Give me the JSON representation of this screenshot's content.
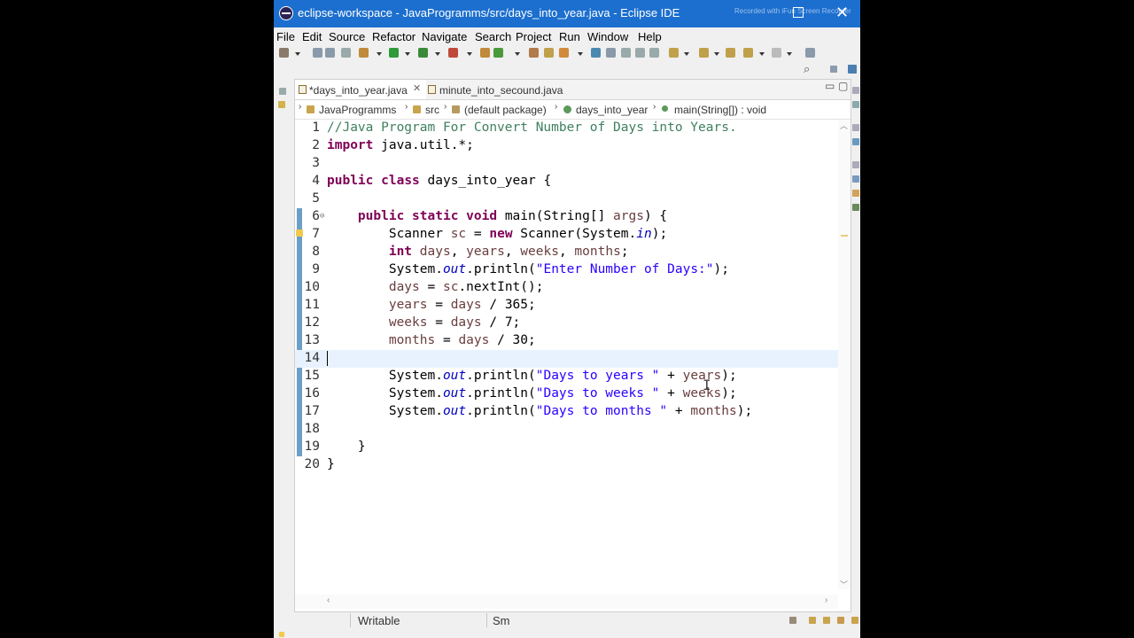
{
  "window": {
    "title": "eclipse-workspace - JavaProgramms/src/days_into_year.java - Eclipse IDE",
    "watermark": "Recorded with iFun Screen Recorder"
  },
  "menu": [
    "File",
    "Edit",
    "Source",
    "Refactor",
    "Navigate",
    "Search",
    "Project",
    "Run",
    "Window",
    "Help"
  ],
  "tabs": [
    {
      "label": "*days_into_year.java",
      "active": true
    },
    {
      "label": "minute_into_secound.java",
      "active": false
    }
  ],
  "breadcrumb": [
    "JavaProgramms",
    "src",
    "(default package)",
    "days_into_year",
    "main(String[]) : void"
  ],
  "code_lines": [
    {
      "n": "1",
      "text": "//Java Program For Convert Number of Days into Years."
    },
    {
      "n": "2",
      "text": "import java.util.*;"
    },
    {
      "n": "3",
      "text": ""
    },
    {
      "n": "4",
      "text": "public class days_into_year {"
    },
    {
      "n": "5",
      "text": ""
    },
    {
      "n": "6",
      "text": "    public static void main(String[] args) {"
    },
    {
      "n": "7",
      "text": "        Scanner sc = new Scanner(System.in);"
    },
    {
      "n": "8",
      "text": "        int days, years, weeks, months;"
    },
    {
      "n": "9",
      "text": "        System.out.println(\"Enter Number of Days:\");"
    },
    {
      "n": "10",
      "text": "        days = sc.nextInt();"
    },
    {
      "n": "11",
      "text": "        years = days / 365;"
    },
    {
      "n": "12",
      "text": "        weeks = days / 7;"
    },
    {
      "n": "13",
      "text": "        months = days / 30;"
    },
    {
      "n": "14",
      "text": ""
    },
    {
      "n": "15",
      "text": "        System.out.println(\"Days to years \" + years);"
    },
    {
      "n": "16",
      "text": "        System.out.println(\"Days to weeks \" + weeks);"
    },
    {
      "n": "17",
      "text": "        System.out.println(\"Days to months \" + months);"
    },
    {
      "n": "18",
      "text": ""
    },
    {
      "n": "19",
      "text": "    }"
    },
    {
      "n": "20",
      "text": "}"
    }
  ],
  "current_line": "14",
  "status": {
    "mode": "Writable",
    "insert": "Sm"
  },
  "colors": {
    "titlebar": "#1c6fce",
    "keyword": "#7f0055",
    "comment": "#3f7f5f",
    "string": "#2a00ff",
    "field": "#0000c0",
    "local_variable": "#6a3e3e",
    "current_line": "#e8f2fe"
  }
}
